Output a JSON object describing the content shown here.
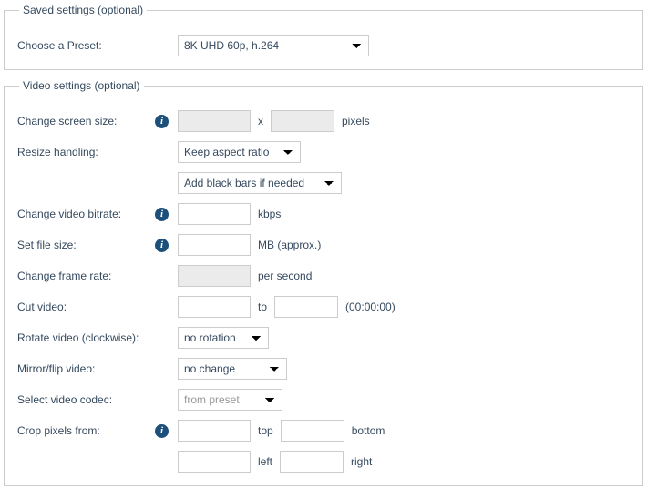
{
  "savedSettings": {
    "legend": "Saved settings (optional)",
    "presetLabel": "Choose a Preset:",
    "presetValue": "8K UHD 60p, h.264"
  },
  "videoSettings": {
    "legend": "Video settings (optional)",
    "screenSize": {
      "label": "Change screen size:",
      "x": "x",
      "unit": "pixels"
    },
    "resize": {
      "label": "Resize handling:",
      "aspect": "Keep aspect ratio",
      "blackbars": "Add black bars if needed"
    },
    "bitrate": {
      "label": "Change video bitrate:",
      "unit": "kbps"
    },
    "filesize": {
      "label": "Set file size:",
      "unit": "MB (approx.)"
    },
    "framerate": {
      "label": "Change frame rate:",
      "unit": "per second"
    },
    "cut": {
      "label": "Cut video:",
      "to": "to",
      "hint": "(00:00:00)"
    },
    "rotate": {
      "label": "Rotate video (clockwise):",
      "value": "no rotation"
    },
    "mirror": {
      "label": "Mirror/flip video:",
      "value": "no change"
    },
    "codec": {
      "label": "Select video codec:",
      "value": "from preset"
    },
    "crop": {
      "label": "Crop pixels from:",
      "top": "top",
      "bottom": "bottom",
      "left": "left",
      "right": "right"
    },
    "infoGlyph": "i"
  }
}
